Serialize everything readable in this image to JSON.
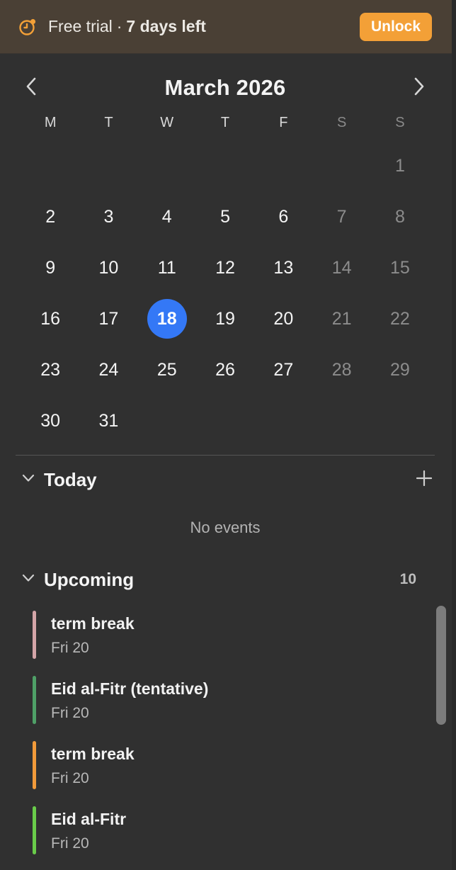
{
  "banner": {
    "label": "Free trial",
    "separator": "·",
    "days_left": "7 days left",
    "unlock_label": "Unlock",
    "accent_color": "#f3a037",
    "icon": "clock-alert-icon"
  },
  "calendar": {
    "month_title": "March 2026",
    "prev_icon": "chevron-left-icon",
    "next_icon": "chevron-right-icon",
    "weekdays": [
      "M",
      "T",
      "W",
      "T",
      "F",
      "S",
      "S"
    ],
    "today_color": "#3478f6",
    "weeks": [
      [
        "",
        "",
        "",
        "",
        "",
        "",
        "1"
      ],
      [
        "2",
        "3",
        "4",
        "5",
        "6",
        "7",
        "8"
      ],
      [
        "9",
        "10",
        "11",
        "12",
        "13",
        "14",
        "15"
      ],
      [
        "16",
        "17",
        "18",
        "19",
        "20",
        "21",
        "22"
      ],
      [
        "23",
        "24",
        "25",
        "26",
        "27",
        "28",
        "29"
      ],
      [
        "30",
        "31",
        "",
        "",
        "",
        "",
        ""
      ]
    ],
    "today": "18"
  },
  "today_section": {
    "title": "Today",
    "empty_text": "No events",
    "add_icon": "plus-icon"
  },
  "upcoming_section": {
    "title": "Upcoming",
    "count": "10",
    "events": [
      {
        "title": "term break",
        "date": "Fri 20",
        "color": "#d4a5a8"
      },
      {
        "title": "Eid al-Fitr (tentative)",
        "date": "Fri 20",
        "color": "#4fa067"
      },
      {
        "title": "term break",
        "date": "Fri 20",
        "color": "#f19a3a"
      },
      {
        "title": "Eid al-Fitr",
        "date": "Fri 20",
        "color": "#69cc4a"
      }
    ]
  }
}
